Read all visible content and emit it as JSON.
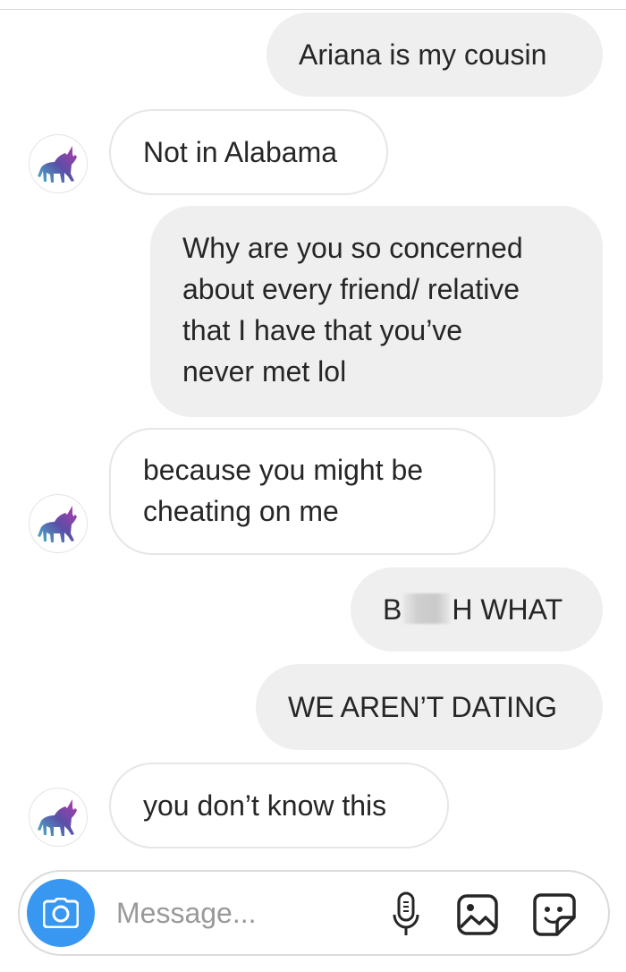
{
  "messages": [
    {
      "side": "sent",
      "text": "Ariana is my cousin"
    },
    {
      "side": "received",
      "text": "Not in Alabama"
    },
    {
      "side": "sent",
      "lines": [
        "Why are you so concerned",
        "about every friend/ relative",
        "that I have that you’ve",
        "never met lol"
      ]
    },
    {
      "side": "received",
      "lines": [
        "because you might be",
        "cheating on me"
      ]
    },
    {
      "side": "sent",
      "prefix": "B",
      "suffix": "H WHAT"
    },
    {
      "side": "sent",
      "text": "WE AREN’T DATING"
    },
    {
      "side": "received",
      "text": "you don’t know this"
    }
  ],
  "composer": {
    "placeholder": "Message...",
    "icons": [
      "camera-icon",
      "microphone-icon",
      "gallery-icon",
      "sticker-icon"
    ]
  },
  "colors": {
    "camera_button": "#3897f0",
    "sent_bubble": "#efefef",
    "received_border": "#e6e6e6",
    "placeholder": "#999999"
  }
}
